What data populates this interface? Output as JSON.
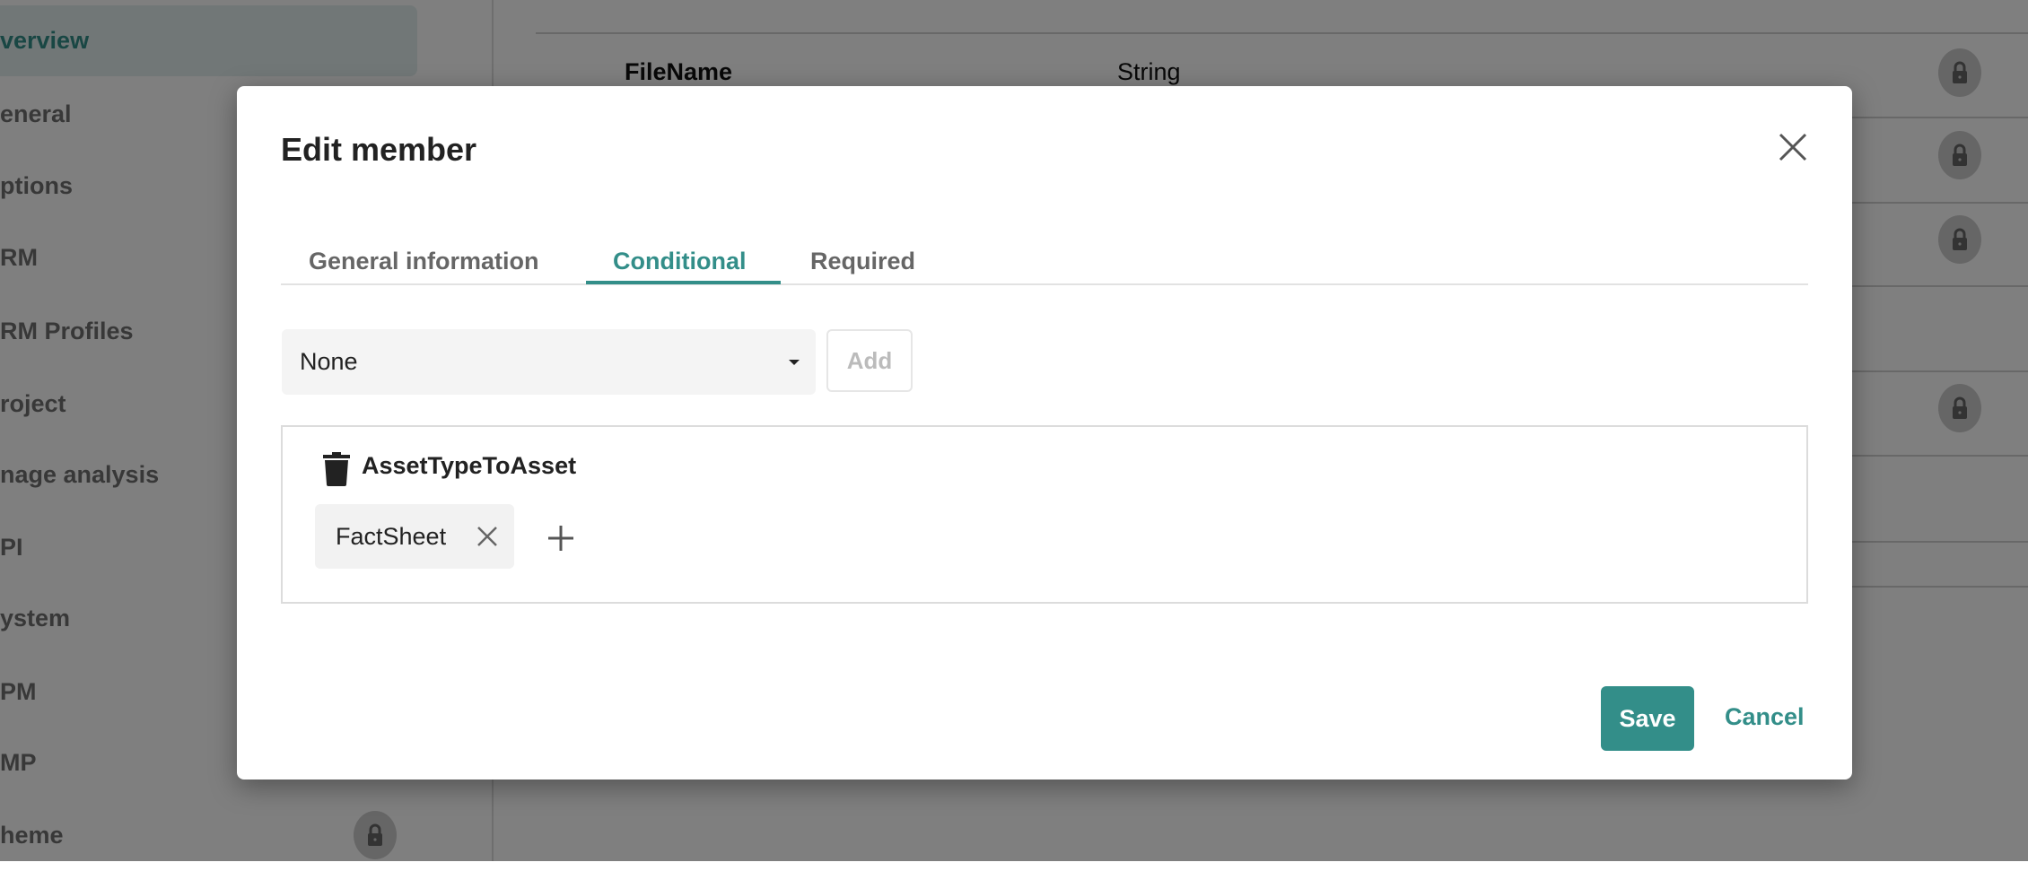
{
  "sidebar": {
    "items": [
      {
        "label": "verview",
        "active": true
      },
      {
        "label": "eneral"
      },
      {
        "label": "ptions"
      },
      {
        "label": "RM"
      },
      {
        "label": "RM Profiles"
      },
      {
        "label": "roject"
      },
      {
        "label": "nage analysis"
      },
      {
        "label": "PI"
      },
      {
        "label": "ystem"
      },
      {
        "label": "PM"
      },
      {
        "label": "MP"
      },
      {
        "label": "heme",
        "locked": true
      }
    ]
  },
  "background_table": {
    "rows": [
      {
        "name": "FileName",
        "type": "String",
        "locked": true
      }
    ]
  },
  "modal": {
    "title": "Edit member",
    "tabs": [
      {
        "label": "General information"
      },
      {
        "label": "Conditional",
        "active": true
      },
      {
        "label": "Required"
      }
    ],
    "condition_select": {
      "value": "None"
    },
    "add_label": "Add",
    "conditions": [
      {
        "name": "AssetTypeToAsset",
        "values": [
          "FactSheet"
        ]
      }
    ],
    "save_label": "Save",
    "cancel_label": "Cancel"
  },
  "colors": {
    "accent": "#338e89"
  }
}
